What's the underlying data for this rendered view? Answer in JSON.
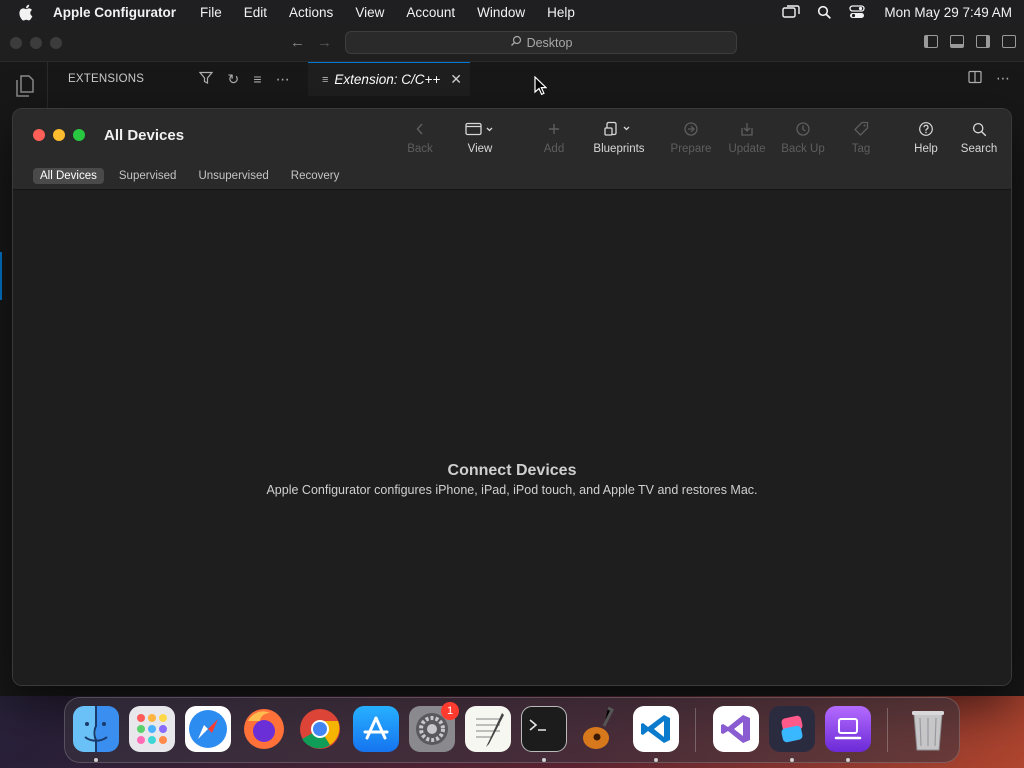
{
  "menubar": {
    "app_name": "Apple Configurator",
    "items": [
      "File",
      "Edit",
      "Actions",
      "View",
      "Account",
      "Window",
      "Help"
    ],
    "clock": "Mon May 29  7:49 AM",
    "status_icons": [
      "screen-mirroring-icon",
      "spotlight-search-icon",
      "control-center-icon"
    ]
  },
  "vscode": {
    "search_text": "Desktop",
    "sidebar_title": "EXTENSIONS",
    "tab_label": "Extension: C/C++"
  },
  "configurator": {
    "window_title": "All Devices",
    "toolbar": {
      "back": "Back",
      "view": "View",
      "add": "Add",
      "blueprints": "Blueprints",
      "prepare": "Prepare",
      "update": "Update",
      "backup": "Back Up",
      "tag": "Tag",
      "help": "Help",
      "search": "Search"
    },
    "scope_tabs": [
      "All Devices",
      "Supervised",
      "Unsupervised",
      "Recovery"
    ],
    "selected_scope": "All Devices",
    "empty_title": "Connect Devices",
    "empty_subtitle": "Apple Configurator configures iPhone, iPad, iPod touch, and Apple TV and restores Mac."
  },
  "dock": {
    "apps": [
      "finder",
      "launchpad",
      "safari",
      "firefox",
      "chrome",
      "app-store",
      "system-settings",
      "textedit",
      "terminal",
      "garageband",
      "vscode",
      "visual-studio",
      "shortcuts",
      "apple-configurator",
      "trash"
    ],
    "system_settings_badge": "1"
  },
  "colors": {
    "accent": "#0078d4",
    "traffic_red": "#ff5f57",
    "traffic_yellow": "#febc2e",
    "traffic_green": "#28c840",
    "badge": "#ff3b30"
  }
}
